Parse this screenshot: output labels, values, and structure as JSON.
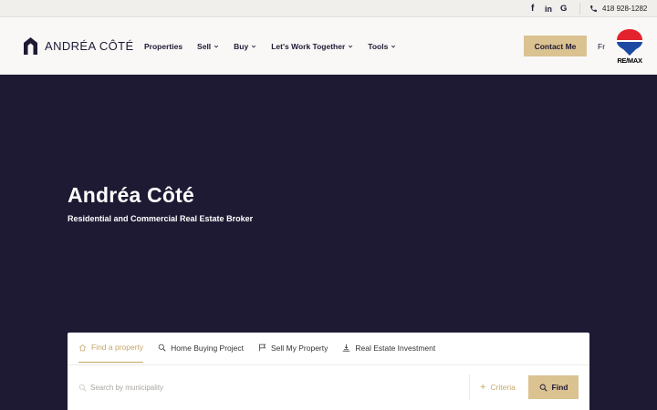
{
  "topbar": {
    "social": [
      {
        "icon": "facebook-icon",
        "glyph": "f"
      },
      {
        "icon": "linkedin-icon",
        "glyph": "in"
      },
      {
        "icon": "google-icon",
        "glyph": "G"
      }
    ],
    "phone": "418 928-1282"
  },
  "header": {
    "brand": "ANDRÉA CÔTÉ",
    "nav": [
      {
        "label": "Properties",
        "dropdown": false
      },
      {
        "label": "Sell",
        "dropdown": true
      },
      {
        "label": "Buy",
        "dropdown": true
      },
      {
        "label": "Let's Work Together",
        "dropdown": true
      },
      {
        "label": "Tools",
        "dropdown": true
      }
    ],
    "contact_label": "Contact Me",
    "lang_label": "Fr",
    "remax_label": "RE/MAX"
  },
  "hero": {
    "title": "Andréa Côté",
    "subtitle": "Residential and Commercial Real Estate Broker"
  },
  "search": {
    "tabs": [
      {
        "label": "Find a property",
        "icon": "home-icon",
        "active": true
      },
      {
        "label": "Home Buying Project",
        "icon": "search-icon",
        "active": false
      },
      {
        "label": "Sell My Property",
        "icon": "flag-icon",
        "active": false
      },
      {
        "label": "Real Estate Investment",
        "icon": "investment-icon",
        "active": false
      }
    ],
    "placeholder": "Search by municipality",
    "criteria_label": "Criteria",
    "find_label": "Find"
  },
  "colors": {
    "navy": "#1e1a33",
    "gold": "#dbc291",
    "gold_text": "#c6a56b"
  }
}
